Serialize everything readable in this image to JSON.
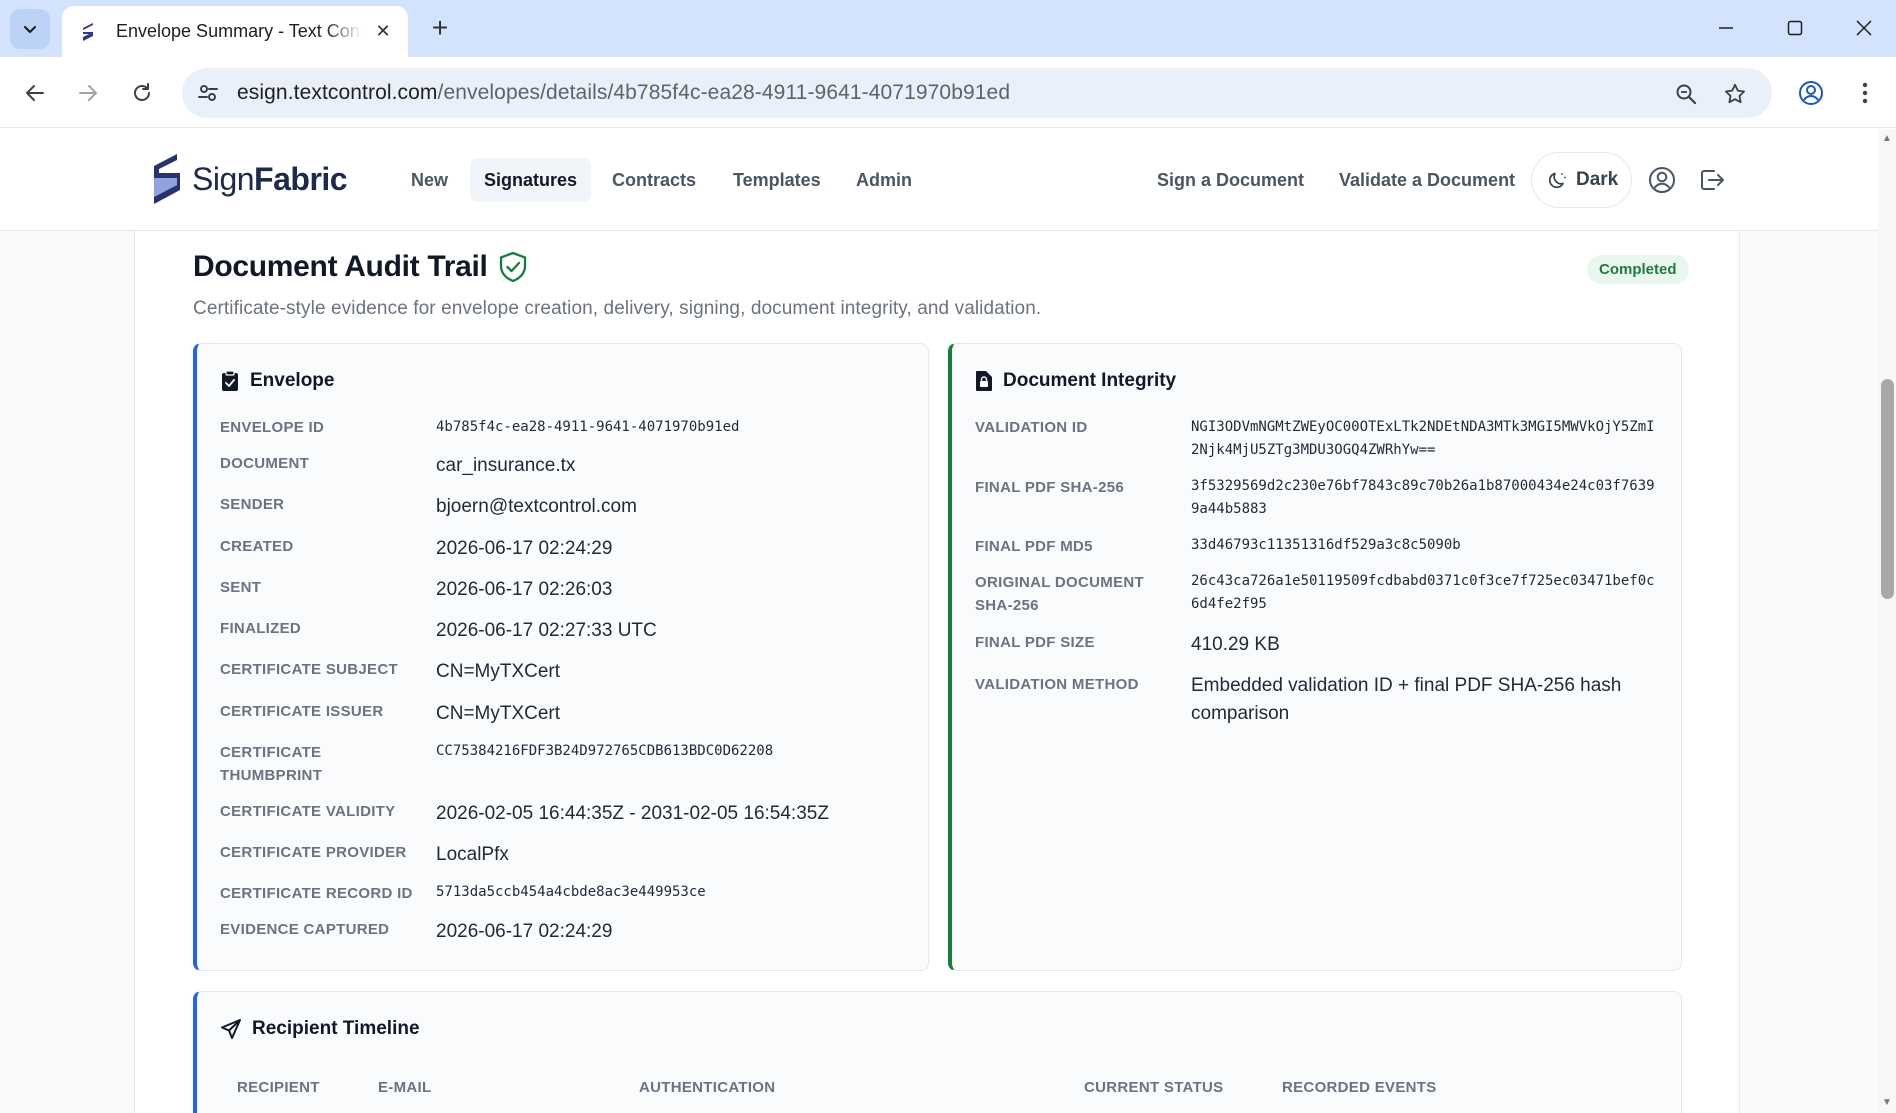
{
  "browser": {
    "tab_title": "Envelope Summary - Text Control",
    "url_host": "esign.textcontrol.com",
    "url_path": "/envelopes/details/4b785f4c-ea28-4911-9641-4071970b91ed"
  },
  "header": {
    "logo_light": "Sign",
    "logo_bold": "Fabric",
    "nav": [
      "New",
      "Signatures",
      "Contracts",
      "Templates",
      "Admin"
    ],
    "active_nav": "Signatures",
    "sign_document": "Sign a Document",
    "validate_document": "Validate a Document",
    "dark_label": "Dark"
  },
  "page": {
    "title": "Document Audit Trail",
    "status": "Completed",
    "subtitle": "Certificate-style evidence for envelope creation, delivery, signing, document integrity, and validation."
  },
  "envelope": {
    "title": "Envelope",
    "rows": [
      {
        "label": "ENVELOPE ID",
        "value": "4b785f4c-ea28-4911-9641-4071970b91ed"
      },
      {
        "label": "DOCUMENT",
        "value": "car_insurance.tx"
      },
      {
        "label": "SENDER",
        "value": "bjoern@textcontrol.com"
      },
      {
        "label": "CREATED",
        "value": "2026-06-17 02:24:29"
      },
      {
        "label": "SENT",
        "value": "2026-06-17 02:26:03"
      },
      {
        "label": "FINALIZED",
        "value": "2026-06-17 02:27:33 UTC"
      },
      {
        "label": "CERTIFICATE SUBJECT",
        "value": "CN=MyTXCert"
      },
      {
        "label": "CERTIFICATE ISSUER",
        "value": "CN=MyTXCert"
      },
      {
        "label": "CERTIFICATE THUMBPRINT",
        "value": "CC75384216FDF3B24D972765CDB613BDC0D62208"
      },
      {
        "label": "CERTIFICATE VALIDITY",
        "value": "2026-02-05 16:44:35Z - 2031-02-05 16:54:35Z"
      },
      {
        "label": "CERTIFICATE PROVIDER",
        "value": "LocalPfx"
      },
      {
        "label": "CERTIFICATE RECORD ID",
        "value": "5713da5ccb454a4cbde8ac3e449953ce"
      },
      {
        "label": "EVIDENCE CAPTURED",
        "value": "2026-06-17 02:24:29"
      }
    ]
  },
  "integrity": {
    "title": "Document Integrity",
    "rows": [
      {
        "label": "VALIDATION ID",
        "value": "NGI3ODVmNGMtZWEyOC00OTExLTk2NDEtNDA3MTk3MGI5MWVkOjY5ZmI2Njk4MjU5ZTg3MDU3OGQ4ZWRhYw=="
      },
      {
        "label": "FINAL PDF SHA-256",
        "value": "3f5329569d2c230e76bf7843c89c70b26a1b87000434e24c03f76399a44b5883"
      },
      {
        "label": "FINAL PDF MD5",
        "value": "33d46793c11351316df529a3c8c5090b"
      },
      {
        "label": "ORIGINAL DOCUMENT SHA-256",
        "value": "26c43ca726a1e50119509fcdbabd0371c0f3ce7f725ec03471bef0c6d4fe2f95"
      },
      {
        "label": "FINAL PDF SIZE",
        "value": "410.29 KB"
      },
      {
        "label": "VALIDATION METHOD",
        "value": "Embedded validation ID + final PDF SHA-256 hash comparison"
      }
    ]
  },
  "timeline": {
    "title": "Recipient Timeline",
    "columns": [
      "RECIPIENT",
      "E-MAIL",
      "AUTHENTICATION",
      "CURRENT STATUS",
      "RECORDED EVENTS"
    ]
  }
}
